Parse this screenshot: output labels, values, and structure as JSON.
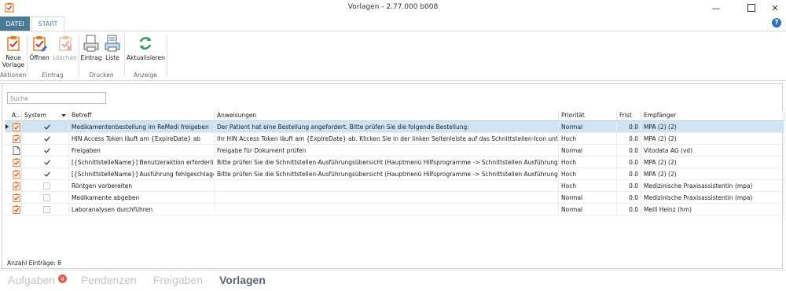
{
  "window": {
    "title": "Vorlagen - 2.77.000 b008"
  },
  "ribbon_tabs": {
    "datei": "DATEI",
    "start": "START"
  },
  "ribbon": {
    "groups": [
      {
        "label": "Aktionen",
        "buttons": [
          {
            "label": "Neue\nVorlage",
            "icon": "new-template-icon",
            "enabled": true
          }
        ]
      },
      {
        "label": "Eintrag",
        "buttons": [
          {
            "label": "Öffnen",
            "icon": "open-icon",
            "enabled": true
          },
          {
            "label": "Löschen",
            "icon": "delete-icon",
            "enabled": false
          }
        ]
      },
      {
        "label": "Drucken",
        "buttons": [
          {
            "label": "Eintrag",
            "icon": "print-entry-icon",
            "enabled": true
          },
          {
            "label": "Liste",
            "icon": "print-list-icon",
            "enabled": true
          }
        ]
      },
      {
        "label": "Anzeige",
        "buttons": [
          {
            "label": "Aktualisieren",
            "icon": "refresh-icon",
            "enabled": true
          }
        ]
      }
    ]
  },
  "search": {
    "placeholder": "Suche"
  },
  "grid": {
    "columns": [
      "A...",
      "System",
      "Betreff",
      "Anweisungen",
      "Priorität",
      "Frist",
      "Empfänger"
    ],
    "rows": [
      {
        "icon": "template-icon",
        "system": true,
        "betreff": "Medikamentenbestellung im ReMedi freigeben",
        "anweisungen": "Der Patient hat eine Bestellung angefordert. Bitte prüfen Sie die folgende Bestellung:",
        "prioritaet": "Normal",
        "frist": "0.0",
        "empfaenger": "MPA (2) (2)",
        "selected": true
      },
      {
        "icon": "template-icon",
        "system": true,
        "betreff": "HIN Access Token läuft am {ExpireDate} ab",
        "anweisungen": "Ihr HIN Access Token läuft am {ExpireDate} ab. Klicken Sie in der linken Seitenleiste auf das Schnittstellen-Icon unterhalb...",
        "prioritaet": "Hoch",
        "frist": "0.0",
        "empfaenger": "MPA (2) (2)",
        "selected": false
      },
      {
        "icon": "document-icon",
        "system": true,
        "betreff": "Freigaben",
        "anweisungen": "Freigabe für Dokument prüfen",
        "prioritaet": "Normal",
        "frist": "0.0",
        "empfaenger": "Vitodata AG  (vd)",
        "selected": false
      },
      {
        "icon": "template-icon",
        "system": true,
        "betreff": "[{SchnittstelleName}] Benutzeraktion erforderlich",
        "anweisungen": "Bitte prüfen Sie die Schnittstellen-Ausführungsübersicht (Hauptmenü Hilfsprogramme -> Schnittstellen Ausführungen)",
        "prioritaet": "Hoch",
        "frist": "0.0",
        "empfaenger": "MPA (2) (2)",
        "selected": false
      },
      {
        "icon": "template-icon",
        "system": true,
        "betreff": "[{SchnittstelleName}] Ausführung fehlgeschlagen",
        "anweisungen": "Bitte prüfen Sie die Schnittstellen-Ausführungsübersicht (Hauptmenü Hilfsprogramme -> Schnittstellen Ausführungen)",
        "prioritaet": "Hoch",
        "frist": "0.0",
        "empfaenger": "MPA (2) (2)",
        "selected": false
      },
      {
        "icon": "template-icon",
        "system": false,
        "betreff": "Röntgen vorbereiten",
        "anweisungen": "",
        "prioritaet": "Hoch",
        "frist": "0.0",
        "empfaenger": "Medizinische Praxisassistentin  (mpa)",
        "selected": false
      },
      {
        "icon": "template-icon",
        "system": false,
        "betreff": "Medikamente abgeben",
        "anweisungen": "",
        "prioritaet": "Normal",
        "frist": "0.0",
        "empfaenger": "Medizinische Praxisassistentin  (mpa)",
        "selected": false
      },
      {
        "icon": "template-icon",
        "system": false,
        "betreff": "Laboranalysen durchführen",
        "anweisungen": "",
        "prioritaet": "Normal",
        "frist": "0.0",
        "empfaenger": "Meili Heinz (hm)",
        "selected": false
      }
    ]
  },
  "status": {
    "count_text": "Anzahl Einträge: 8"
  },
  "bottom_nav": {
    "items": [
      {
        "label": "Aufgaben",
        "badge": "4",
        "active": false
      },
      {
        "label": "Pendenzen",
        "badge": "",
        "active": false
      },
      {
        "label": "Freigaben",
        "badge": "",
        "active": false
      },
      {
        "label": "Vorlagen",
        "badge": "",
        "active": true
      }
    ]
  },
  "colors": {
    "accent": "#4a7a93",
    "selection": "#cfe3f3",
    "badge": "#e25a4f",
    "help": "#2a73b8"
  }
}
